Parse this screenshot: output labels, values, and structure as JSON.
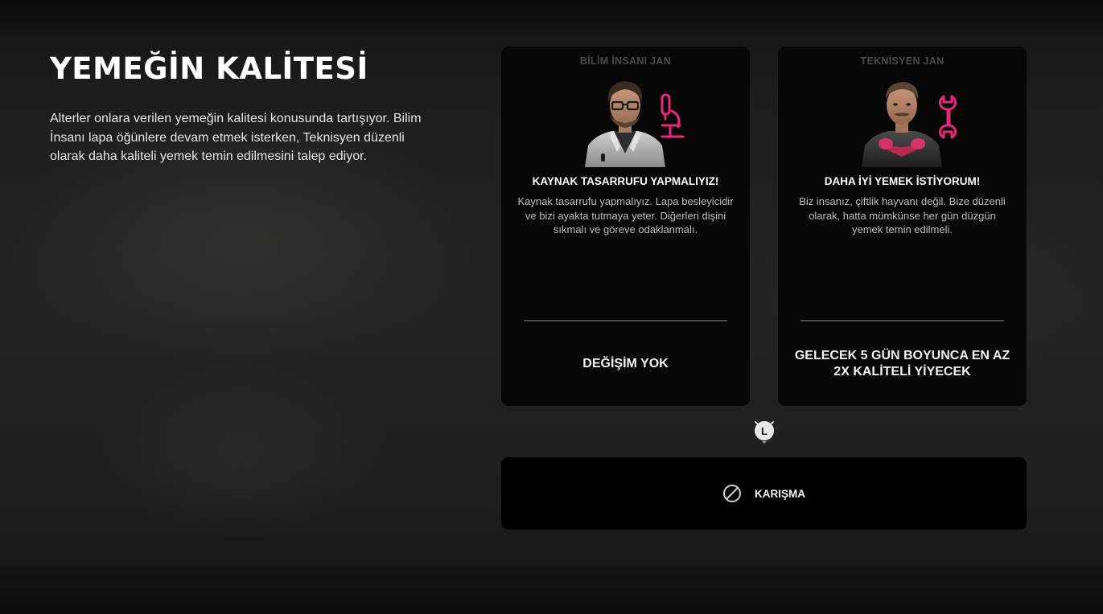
{
  "event": {
    "title": "YEMEĞİN KALİTESİ",
    "description": "Alterler onlara verilen yemeğin kalitesi konusunda tartışıyor. Bilim İnsanı lapa öğünlere devam etmek isterken, Teknisyen düzenli olarak daha kaliteli yemek temin edilmesini talep ediyor."
  },
  "options": [
    {
      "name": "BİLİM İNSANI JAN",
      "role_icon": "microscope-icon",
      "heading": "KAYNAK TASARRUFU YAPMALIYIZ!",
      "text": "Kaynak tasarrufu yapmalıyız. Lapa besleyicidir ve bizi ayakta tutmaya yeter. Diğerleri dişini sıkmalı ve göreve odaklanmalı.",
      "effect": "DEĞİŞİM YOK"
    },
    {
      "name": "TEKNİSYEN JAN",
      "role_icon": "wrench-icon",
      "heading": "DAHA İYİ YEMEK İSTİYORUM!",
      "text": "Biz insanız, çiftlik hayvanı değil. Bize düzenli olarak, hatta mümkünse her gün düzgün yemek temin edilmeli.",
      "effect": "GELECEK 5 GÜN BOYUNCA EN AZ 2X KALİTELİ YİYECEK"
    }
  ],
  "timer": {
    "icon": "timer-icon",
    "key": "L"
  },
  "ignore": {
    "label": "KARIŞMA",
    "icon": "forbidden-icon"
  },
  "colors": {
    "accent": "#e8287a",
    "card_bg": "#070707",
    "button_bg": "#000000",
    "muted_label": "#4b4b4b"
  }
}
